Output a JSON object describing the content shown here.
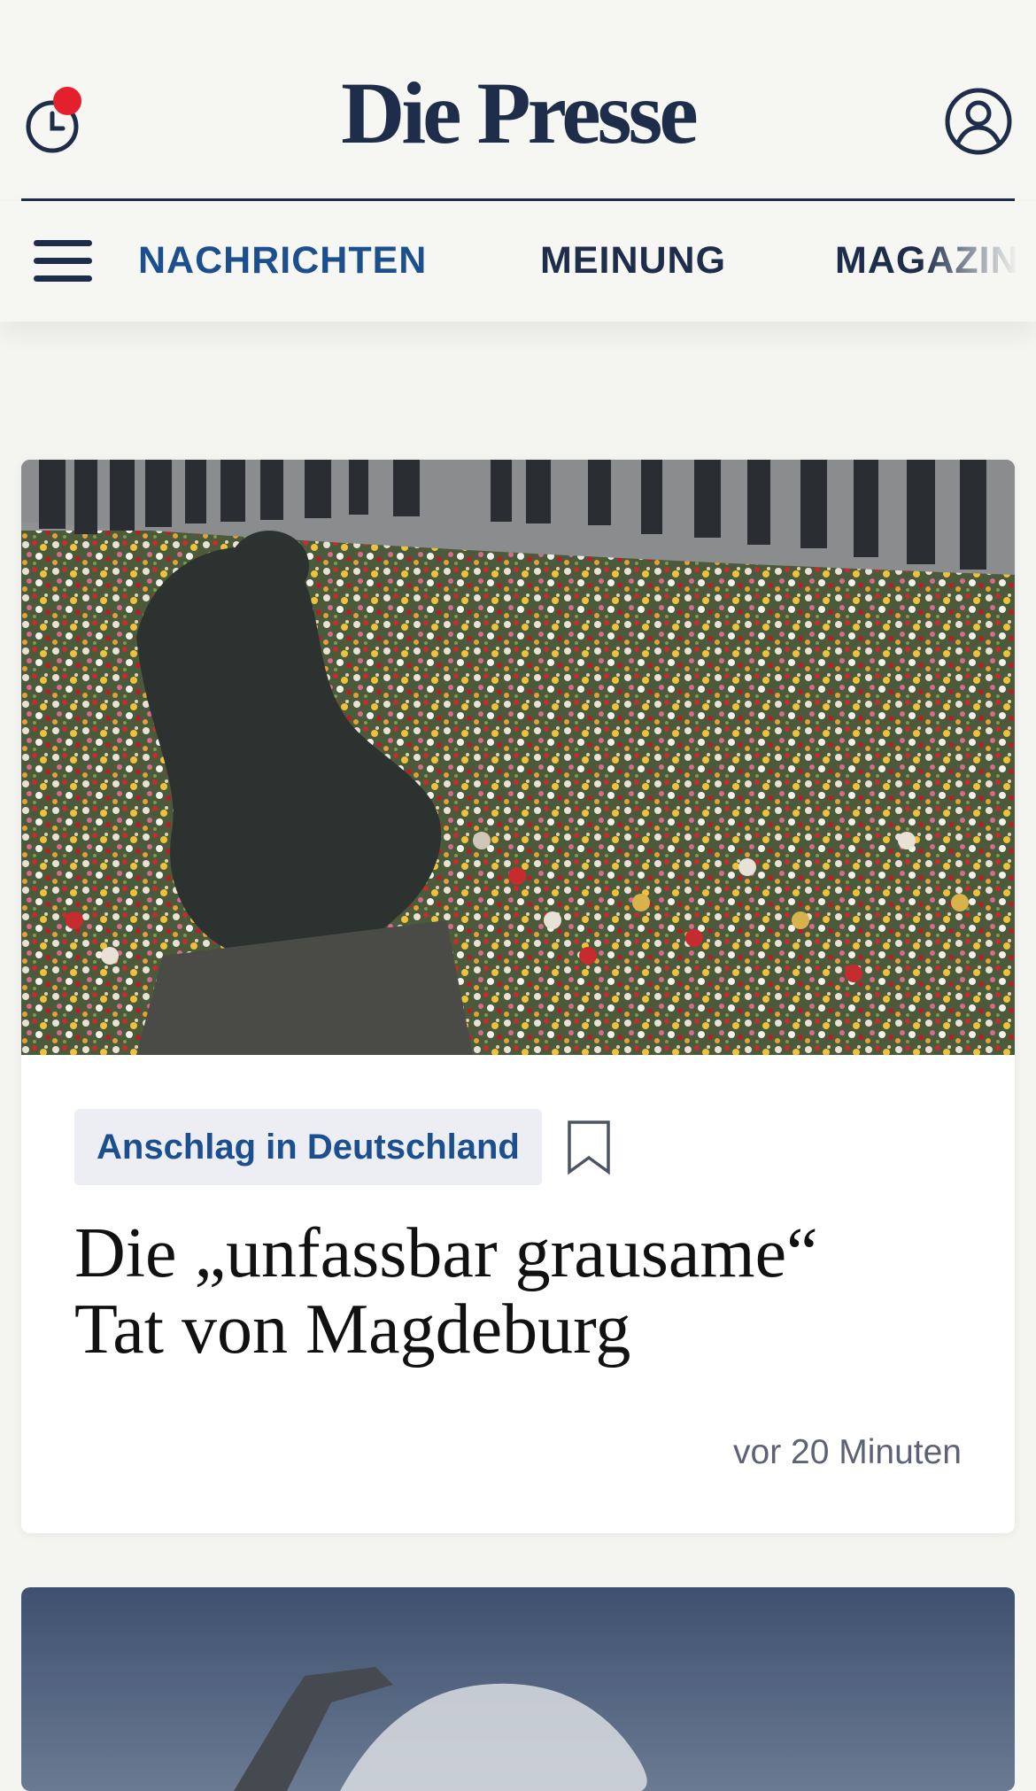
{
  "header": {
    "brand": "Die Presse",
    "history_icon": "clock-icon",
    "notification_color": "#e3202b",
    "account_icon": "user-icon"
  },
  "nav": {
    "menu_icon": "menu-icon",
    "items": [
      {
        "label": "NACHRICHTEN",
        "active": true,
        "color": "#1c4f8d"
      },
      {
        "label": "MEINUNG",
        "active": false,
        "color": "#1e2d4a"
      },
      {
        "label": "MAGAZIN",
        "active": false,
        "color": "#1e2d4a"
      }
    ]
  },
  "articles": [
    {
      "tag": "Anschlag in Deutschland",
      "headline_line1": "Die „unfassbar grausame“",
      "headline_line2": "Tat von Magdeburg",
      "time": "vor 20 Minuten",
      "bookmark_icon": "bookmark-icon"
    }
  ],
  "colors": {
    "brand_navy": "#1e2d4a",
    "accent_blue": "#1c4f8d",
    "background": "#f4f4f1"
  }
}
